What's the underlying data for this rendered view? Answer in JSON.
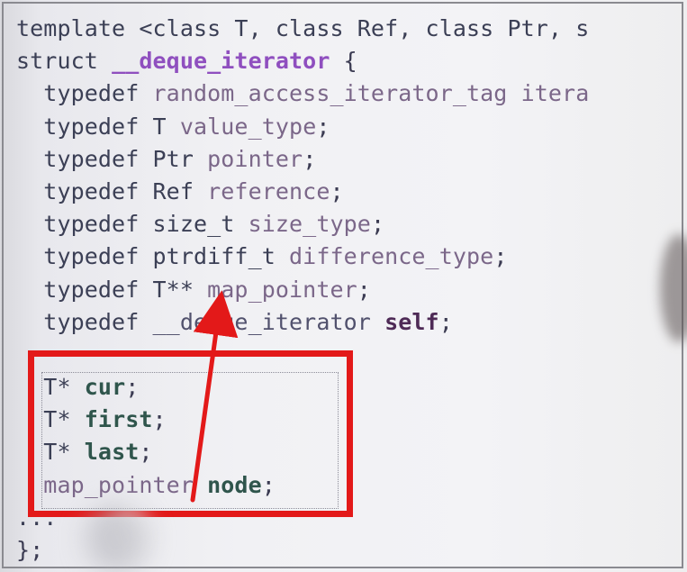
{
  "code": {
    "lines": [
      [
        {
          "text": "template <class T, class Ref, class Ptr, s",
          "class": "kw"
        }
      ],
      [
        {
          "text": "struct ",
          "class": "kw"
        },
        {
          "text": "__deque_iterator",
          "class": "purple"
        },
        {
          "text": " {",
          "class": "punct"
        }
      ],
      [
        {
          "text": "  typedef ",
          "class": "kw"
        },
        {
          "text": "random_access_iterator_tag itera",
          "class": "type"
        }
      ],
      [
        {
          "text": "  typedef ",
          "class": "kw"
        },
        {
          "text": "T ",
          "class": "kw"
        },
        {
          "text": "value_type",
          "class": "type"
        },
        {
          "text": ";",
          "class": "punct"
        }
      ],
      [
        {
          "text": "  typedef ",
          "class": "kw"
        },
        {
          "text": "Ptr ",
          "class": "kw"
        },
        {
          "text": "pointer",
          "class": "type"
        },
        {
          "text": ";",
          "class": "punct"
        }
      ],
      [
        {
          "text": "  typedef ",
          "class": "kw"
        },
        {
          "text": "Ref ",
          "class": "kw"
        },
        {
          "text": "reference",
          "class": "type"
        },
        {
          "text": ";",
          "class": "punct"
        }
      ],
      [
        {
          "text": "  typedef ",
          "class": "kw"
        },
        {
          "text": "size_t ",
          "class": "kw"
        },
        {
          "text": "size_type",
          "class": "type"
        },
        {
          "text": ";",
          "class": "punct"
        }
      ],
      [
        {
          "text": "  typedef ",
          "class": "kw"
        },
        {
          "text": "ptrdiff_t ",
          "class": "kw"
        },
        {
          "text": "difference_type",
          "class": "type"
        },
        {
          "text": ";",
          "class": "punct"
        }
      ],
      [
        {
          "text": "  typedef ",
          "class": "kw"
        },
        {
          "text": "T** ",
          "class": "kw"
        },
        {
          "text": "map_pointer",
          "class": "type"
        },
        {
          "text": ";",
          "class": "punct"
        }
      ],
      [
        {
          "text": "  typedef ",
          "class": "kw"
        },
        {
          "text": "__deque_iterator ",
          "class": "ident"
        },
        {
          "text": "self",
          "class": "bold-dark"
        },
        {
          "text": ";",
          "class": "punct"
        }
      ],
      [
        {
          "text": "",
          "class": "kw"
        }
      ],
      [
        {
          "text": "  T* ",
          "class": "kw"
        },
        {
          "text": "cur",
          "class": "bold-green"
        },
        {
          "text": ";",
          "class": "punct"
        }
      ],
      [
        {
          "text": "  T* ",
          "class": "kw"
        },
        {
          "text": "first",
          "class": "bold-green"
        },
        {
          "text": ";",
          "class": "punct"
        }
      ],
      [
        {
          "text": "  T* ",
          "class": "kw"
        },
        {
          "text": "last",
          "class": "bold-green"
        },
        {
          "text": ";",
          "class": "punct"
        }
      ],
      [
        {
          "text": "  map_pointer ",
          "class": "type"
        },
        {
          "text": "node",
          "class": "bold-green"
        },
        {
          "text": ";",
          "class": "punct"
        }
      ],
      [
        {
          "text": "...",
          "class": "kw"
        }
      ],
      [
        {
          "text": "};",
          "class": "punct"
        }
      ]
    ]
  },
  "annotation": {
    "highlight_color": "#e31919",
    "arrow_color": "#e31919"
  }
}
